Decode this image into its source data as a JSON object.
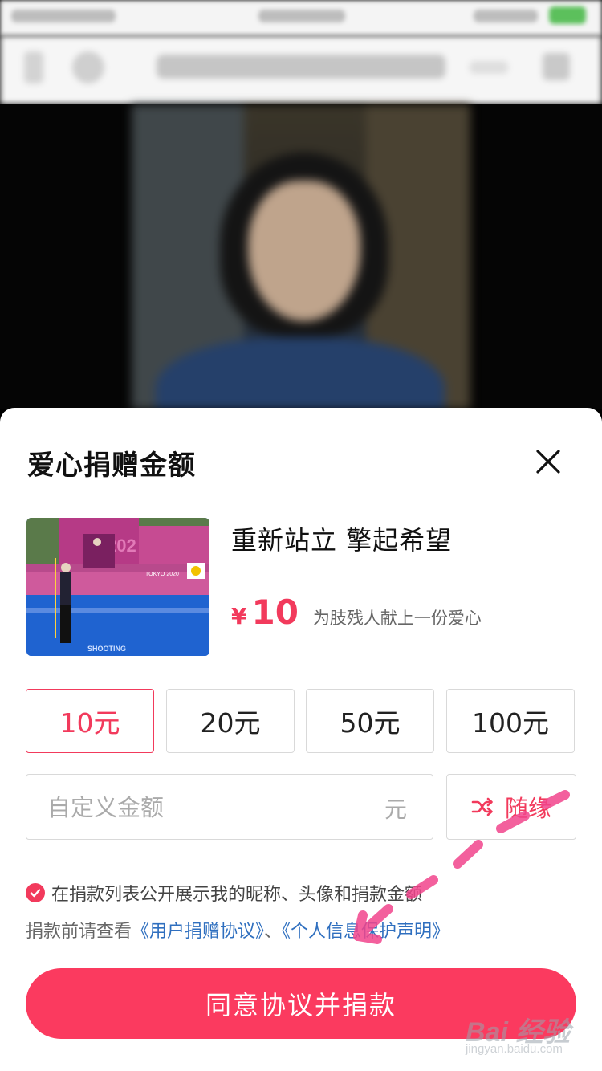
{
  "sheet": {
    "title": "爱心捐赠金额",
    "close_icon": "close-icon"
  },
  "project": {
    "name": "重新站立 擎起希望",
    "currency_symbol": "¥",
    "price": "10",
    "description": "为肢残人献上一份爱心",
    "thumb_labels": {
      "event": "TOKYO 2020",
      "floor": "SHOOTING"
    }
  },
  "amounts": [
    {
      "label": "10元",
      "selected": true
    },
    {
      "label": "20元",
      "selected": false
    },
    {
      "label": "50元",
      "selected": false
    },
    {
      "label": "100元",
      "selected": false
    }
  ],
  "custom_amount": {
    "placeholder": "自定义金额",
    "value": "",
    "unit": "元"
  },
  "random": {
    "icon": "shuffle-icon",
    "label": "随缘"
  },
  "consent": {
    "checked": true,
    "text": "在捐款列表公开展示我的昵称、头像和捐款金额"
  },
  "agreement": {
    "prefix": "捐款前请查看",
    "link1": "《用户捐赠协议》",
    "separator": "、",
    "link2": "《个人信息保护声明》"
  },
  "donate_button": {
    "label": "同意协议并捐款"
  },
  "watermark": {
    "main": "Bai 经验",
    "sub": "jingyan.baidu.com"
  },
  "colors": {
    "accent": "#f23a5c",
    "button": "#fb3a5f",
    "link": "#2f6fbf"
  }
}
